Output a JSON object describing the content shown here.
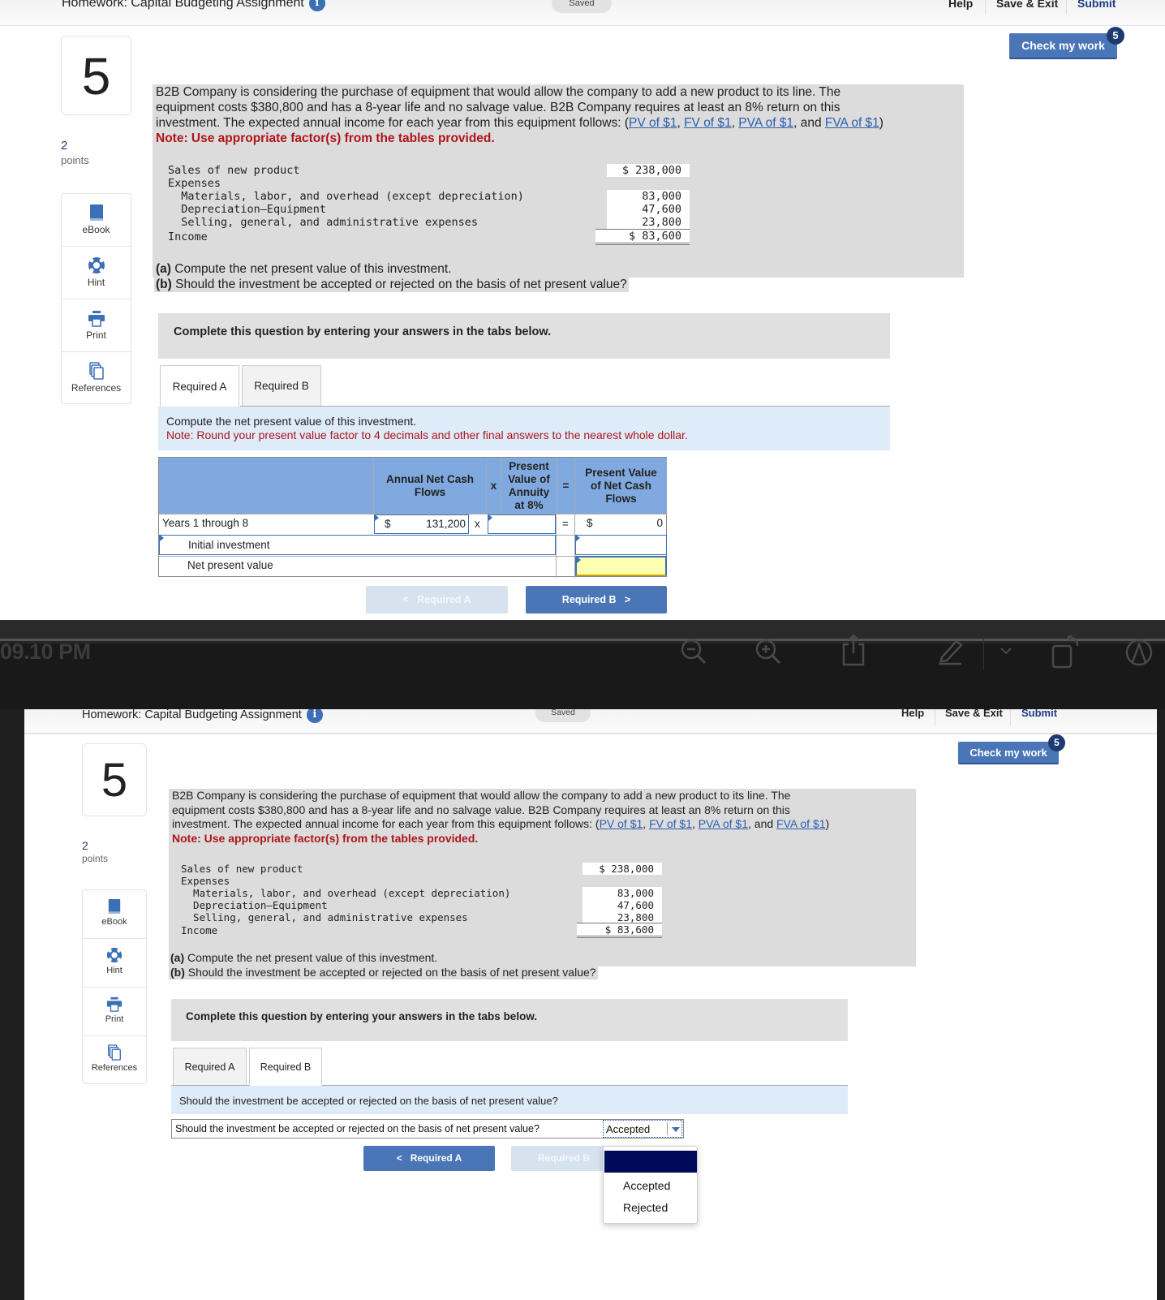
{
  "header": {
    "title": "Homework: Capital Budgeting Assignment",
    "info_icon": "info-icon",
    "saved_label": "Saved",
    "nav": [
      "Help",
      "Save & Exit",
      "Submit"
    ],
    "check_label": "Check my work",
    "check_badge": "5"
  },
  "question": {
    "number": "5",
    "points_value": "2",
    "points_label": "points"
  },
  "tools": [
    {
      "label": "eBook",
      "icon": "book-icon"
    },
    {
      "label": "Hint",
      "icon": "lifebuoy-icon"
    },
    {
      "label": "Print",
      "icon": "printer-icon"
    },
    {
      "label": "References",
      "icon": "copy-pages-icon"
    }
  ],
  "problem": {
    "text_line1": "B2B Company is considering the purchase of equipment that would allow the company to add a new product to its line. The",
    "text_line2": "equipment costs $380,800 and has a 8-year life and no salvage value. B2B Company requires at least an 8% return on this",
    "text_line3_prefix": "investment. The expected annual income for each year from this equipment follows: (",
    "links": [
      "PV of $1",
      "FV of $1",
      "PVA of $1",
      "FVA of $1"
    ],
    "sep1": ", ",
    "sep2": ", ",
    "sep3": ", and ",
    "suffix": ")",
    "note": "Note: Use appropriate factor(s) from the tables provided."
  },
  "income_statement": {
    "rows": [
      {
        "label": "Sales of new product",
        "value": "$ 238,000"
      },
      {
        "label": "Expenses",
        "value": ""
      },
      {
        "label": "  Materials, labor, and overhead (except depreciation)",
        "value": "83,000"
      },
      {
        "label": "  Depreciation—Equipment",
        "value": "47,600"
      },
      {
        "label": "  Selling, general, and administrative expenses",
        "value": "23,800"
      },
      {
        "label": "Income",
        "value": "$ 83,600"
      }
    ]
  },
  "parts": {
    "a_label": "(a)",
    "a_text": " Compute the net present value of this investment.",
    "b_label": "(b)",
    "b_text": " Should the investment be accepted or rejected on the basis of net present value?"
  },
  "complete_prompt": "Complete this question by entering your answers in the tabs below.",
  "tabs": [
    "Required A",
    "Required B"
  ],
  "required_a": {
    "instruction": "Compute the net present value of this investment.",
    "note": "Note: Round your present value factor to 4 decimals and other final answers to the nearest whole dollar.",
    "table": {
      "headers": {
        "cash_flows": "Annual Net Cash Flows",
        "times": "x",
        "pv_factor": "Present Value of Annuity at 8%",
        "equals": "=",
        "pv": "Present Value of Net Cash Flows"
      },
      "rows": [
        {
          "label": "Years 1 through 8",
          "currency": "$",
          "cash_flow": "131,200",
          "times": "x",
          "factor": "",
          "equals": "=",
          "pv_currency": "$",
          "pv": "0"
        },
        {
          "label": "Initial investment",
          "pv": ""
        },
        {
          "label": "Net present value",
          "pv": ""
        }
      ]
    },
    "prev_label": "Required A",
    "next_label": "Required B"
  },
  "viewer": {
    "clock": "09.10 PM",
    "icons": [
      "zoom-out-icon",
      "zoom-in-icon",
      "share-icon",
      "pencil-markup-icon",
      "chevron-down-icon",
      "rotate-icon",
      "markup-circle-icon"
    ]
  },
  "required_b": {
    "instruction": "Should the investment be accepted or rejected on the basis of net present value?",
    "row_label": "Should the investment be accepted or rejected on the basis of net present value?",
    "selected": "Accepted",
    "options": [
      "Accepted",
      "Rejected"
    ],
    "prev_label": "Required A",
    "next_label": "Required B"
  }
}
